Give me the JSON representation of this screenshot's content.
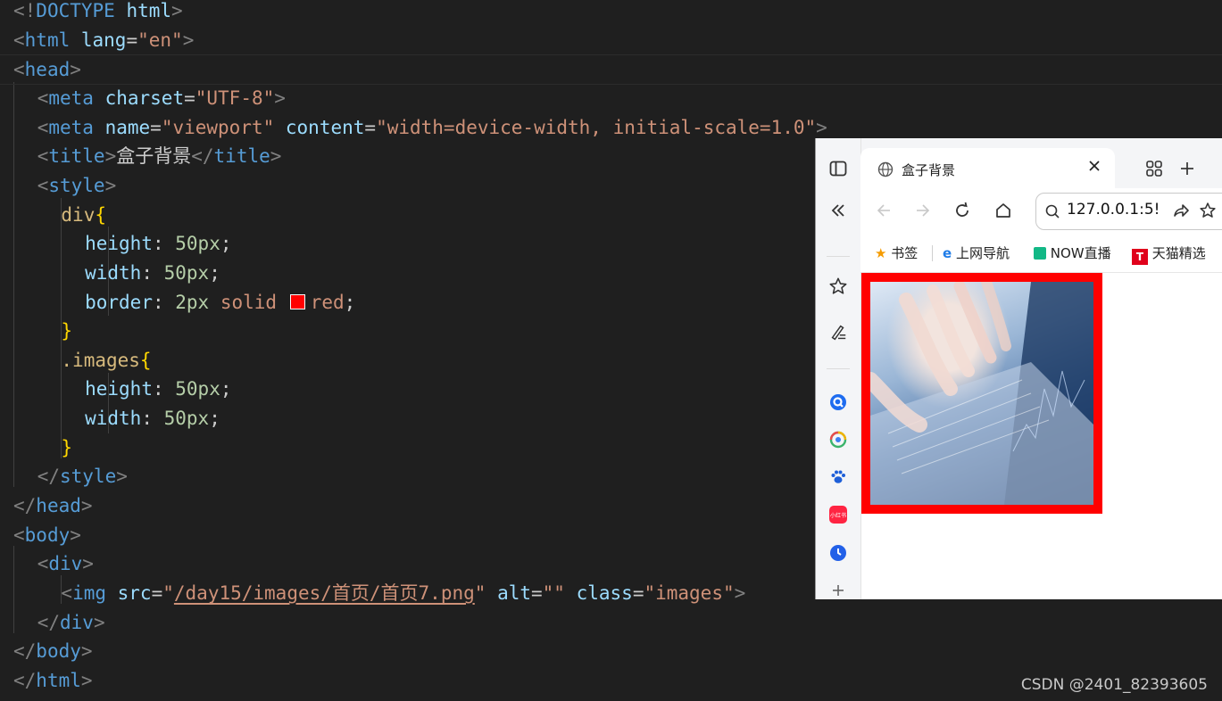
{
  "code_lines": [
    [
      [
        "t-br",
        "<!"
      ],
      [
        "t-tag",
        "DOCTYPE"
      ],
      [
        "t-attr",
        " html"
      ],
      [
        "t-br",
        ">"
      ]
    ],
    [
      [
        "t-br",
        "<"
      ],
      [
        "t-tag",
        "html"
      ],
      [
        "t-attr",
        " lang"
      ],
      [
        "t-eq",
        "="
      ],
      [
        "t-str",
        "\"en\""
      ],
      [
        "t-br",
        ">"
      ]
    ],
    [
      [
        "t-br",
        "<"
      ],
      [
        "t-tag",
        "head"
      ],
      [
        "t-br",
        ">"
      ]
    ],
    [
      [
        "t-txt",
        "    "
      ],
      [
        "t-br",
        "<"
      ],
      [
        "t-tag",
        "meta"
      ],
      [
        "t-attr",
        " charset"
      ],
      [
        "t-eq",
        "="
      ],
      [
        "t-str",
        "\"UTF-8\""
      ],
      [
        "t-br",
        ">"
      ]
    ],
    [
      [
        "t-txt",
        "    "
      ],
      [
        "t-br",
        "<"
      ],
      [
        "t-tag",
        "meta"
      ],
      [
        "t-attr",
        " name"
      ],
      [
        "t-eq",
        "="
      ],
      [
        "t-str",
        "\"viewport\""
      ],
      [
        "t-attr",
        " content"
      ],
      [
        "t-eq",
        "="
      ],
      [
        "t-str",
        "\"width=device-width, initial-scale=1.0\""
      ],
      [
        "t-br",
        ">"
      ]
    ],
    [
      [
        "t-txt",
        "    "
      ],
      [
        "t-br",
        "<"
      ],
      [
        "t-tag",
        "title"
      ],
      [
        "t-br",
        ">"
      ],
      [
        "t-txt",
        "盒子背景"
      ],
      [
        "t-br",
        "</"
      ],
      [
        "t-tag",
        "title"
      ],
      [
        "t-br",
        ">"
      ]
    ],
    [
      [
        "t-txt",
        "    "
      ],
      [
        "t-br",
        "<"
      ],
      [
        "t-tag",
        "style"
      ],
      [
        "t-br",
        ">"
      ]
    ],
    [
      [
        "t-txt",
        "        "
      ],
      [
        "t-sel",
        "div"
      ],
      [
        "t-curly",
        "{"
      ]
    ],
    [
      [
        "t-txt",
        "            "
      ],
      [
        "t-prop",
        "height"
      ],
      [
        "t-eq",
        ": "
      ],
      [
        "t-num",
        "50px"
      ],
      [
        "t-eq",
        ";"
      ]
    ],
    [
      [
        "t-txt",
        "            "
      ],
      [
        "t-prop",
        "width"
      ],
      [
        "t-eq",
        ": "
      ],
      [
        "t-num",
        "50px"
      ],
      [
        "t-eq",
        ";"
      ]
    ],
    [
      [
        "t-txt",
        "            "
      ],
      [
        "t-prop",
        "border"
      ],
      [
        "t-eq",
        ": "
      ],
      [
        "t-num",
        "2px"
      ],
      [
        "t-val",
        " solid "
      ],
      [
        "swatch",
        ""
      ],
      [
        "t-val",
        "red"
      ],
      [
        "t-eq",
        ";"
      ]
    ],
    [
      [
        "t-txt",
        "        "
      ],
      [
        "t-curly",
        "}"
      ]
    ],
    [
      [
        "t-txt",
        "        "
      ],
      [
        "t-sel",
        ".images"
      ],
      [
        "t-curly",
        "{"
      ]
    ],
    [
      [
        "t-txt",
        "            "
      ],
      [
        "t-prop",
        "height"
      ],
      [
        "t-eq",
        ": "
      ],
      [
        "t-num",
        "50px"
      ],
      [
        "t-eq",
        ";"
      ]
    ],
    [
      [
        "t-txt",
        "            "
      ],
      [
        "t-prop",
        "width"
      ],
      [
        "t-eq",
        ": "
      ],
      [
        "t-num",
        "50px"
      ],
      [
        "t-eq",
        ";"
      ]
    ],
    [
      [
        "t-txt",
        "        "
      ],
      [
        "t-curly",
        "}"
      ]
    ],
    [
      [
        "t-txt",
        "    "
      ],
      [
        "t-br",
        "</"
      ],
      [
        "t-tag",
        "style"
      ],
      [
        "t-br",
        ">"
      ]
    ],
    [
      [
        "t-br",
        "</"
      ],
      [
        "t-tag",
        "head"
      ],
      [
        "t-br",
        ">"
      ]
    ],
    [
      [
        "t-br",
        "<"
      ],
      [
        "t-tag",
        "body"
      ],
      [
        "t-br",
        ">"
      ]
    ],
    [
      [
        "t-txt",
        "    "
      ],
      [
        "t-br",
        "<"
      ],
      [
        "t-tag",
        "div"
      ],
      [
        "t-br",
        ">"
      ]
    ],
    [
      [
        "t-txt",
        "        "
      ],
      [
        "t-br",
        "<"
      ],
      [
        "t-tag",
        "img"
      ],
      [
        "t-attr",
        " src"
      ],
      [
        "t-eq",
        "="
      ],
      [
        "t-str",
        "\""
      ],
      [
        "t-link",
        "/day15/images/首页/首页7.png"
      ],
      [
        "t-str",
        "\""
      ],
      [
        "t-attr",
        " alt"
      ],
      [
        "t-eq",
        "="
      ],
      [
        "t-str",
        "\"\""
      ],
      [
        "t-attr",
        " class"
      ],
      [
        "t-eq",
        "="
      ],
      [
        "t-str",
        "\"images\""
      ],
      [
        "t-br",
        ">"
      ]
    ],
    [
      [
        "t-txt",
        "    "
      ],
      [
        "t-br",
        "</"
      ],
      [
        "t-tag",
        "div"
      ],
      [
        "t-br",
        ">"
      ]
    ],
    [
      [
        "t-br",
        "</"
      ],
      [
        "t-tag",
        "body"
      ],
      [
        "t-br",
        ">"
      ]
    ],
    [
      [
        "t-br",
        "</"
      ],
      [
        "t-tag",
        "html"
      ],
      [
        "t-br",
        ">"
      ]
    ]
  ],
  "browser": {
    "tab_title": "盒子背景",
    "address": "127.0.0.1:5!",
    "bookmarks": [
      "书签",
      "上网导航",
      "NOW直播",
      "天猫精选"
    ],
    "side_app_label": "小红书"
  },
  "watermark": "CSDN @2401_82393605",
  "colors": {
    "editor_bg": "#1f1f1f",
    "border_red": "#ff0000"
  }
}
